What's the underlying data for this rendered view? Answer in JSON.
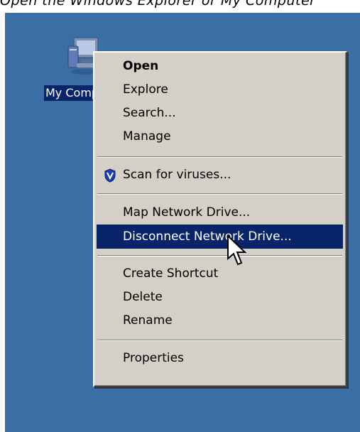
{
  "caption": "Open the Windows Explorer or My Computer",
  "desktop": {
    "background": "#3a6ea5",
    "icon": {
      "icon_name": "my-computer-icon",
      "label": "My Computer"
    }
  },
  "context_menu": {
    "highlight_color": "#0a246a",
    "items": {
      "open": "Open",
      "explore": "Explore",
      "search": "Search...",
      "manage": "Manage",
      "scan": "Scan for viruses...",
      "map_drive": "Map Network Drive...",
      "disconnect_drive": "Disconnect Network Drive...",
      "create_shortcut": "Create Shortcut",
      "delete": "Delete",
      "rename": "Rename",
      "properties": "Properties"
    },
    "scan_icon": "antivirus-shield-icon",
    "highlighted_item": "Disconnect Network Drive..."
  },
  "cursor": {
    "icon_name": "arrow-pointer-icon"
  }
}
